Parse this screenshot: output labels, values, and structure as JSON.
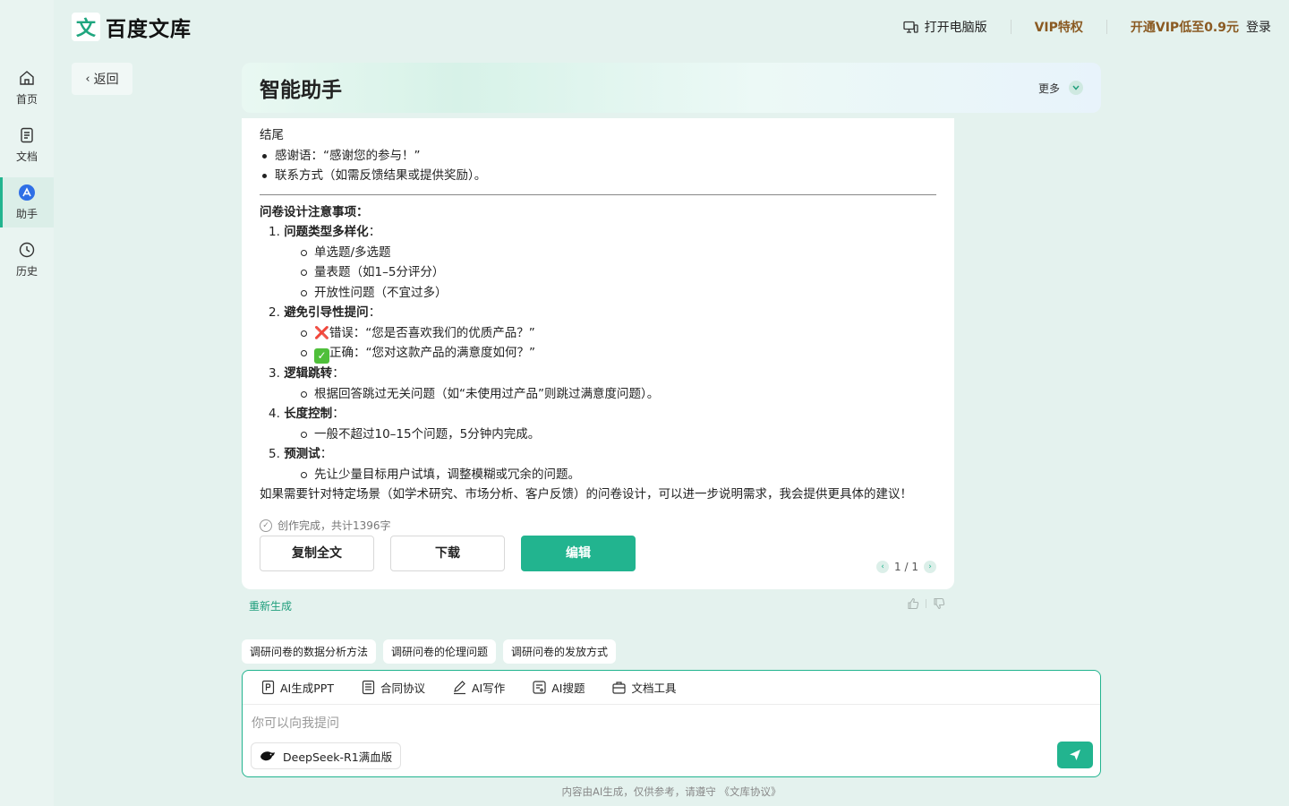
{
  "brand": {
    "mark": "文",
    "name": "百度文库"
  },
  "rail": {
    "items": [
      {
        "label": "首页",
        "icon": "home-icon"
      },
      {
        "label": "文档",
        "icon": "document-icon"
      },
      {
        "label": "助手",
        "icon": "assistant-icon",
        "active": true
      },
      {
        "label": "历史",
        "icon": "clock-icon"
      }
    ]
  },
  "topnav": {
    "desktop": "打开电脑版",
    "vip": "VIP特权",
    "vip_promo": "开通VIP低至0.9元",
    "login": "登录"
  },
  "back": {
    "label": "返回"
  },
  "assistant": {
    "title": "智能助手",
    "more": "更多"
  },
  "answer": {
    "ending_heading": "结尾",
    "ending_bullets": [
      "感谢语：“感谢您的参与！”",
      "联系方式（如需反馈结果或提供奖励）。"
    ],
    "notes_heading": "问卷设计注意事项：",
    "sections": [
      {
        "num": "1.",
        "title": "问题类型多样化",
        "colon": "：",
        "items": [
          "单选题/多选题",
          "量表题（如1–5分评分）",
          "开放性问题（不宜过多）"
        ]
      },
      {
        "num": "2.",
        "title": "避免引导性提问",
        "colon": "：",
        "items": [
          "错误：“您是否喜欢我们的优质产品？”",
          "正确：“您对这款产品的满意度如何？”"
        ]
      },
      {
        "num": "3.",
        "title": "逻辑跳转",
        "colon": "：",
        "items": [
          "根据回答跳过无关问题（如“未使用过产品”则跳过满意度问题）。"
        ]
      },
      {
        "num": "4.",
        "title": "长度控制",
        "colon": "：",
        "items": [
          "一般不超过10–15个问题，5分钟内完成。"
        ]
      },
      {
        "num": "5.",
        "title": "预测试",
        "colon": "：",
        "items": [
          "先让少量目标用户试填，调整模糊或冗余的问题。"
        ]
      }
    ],
    "closing": "如果需要针对特定场景（如学术研究、市场分析、客户反馈）的问卷设计，可以进一步说明需求，我会提供更具体的建议！",
    "status": "创作完成，共计1396字",
    "buttons": {
      "copy": "复制全文",
      "download": "下载",
      "edit": "编辑"
    },
    "pager": "1 / 1",
    "emoji": {
      "wrong": "❌",
      "right": "✓"
    }
  },
  "regenerate": "重新生成",
  "suggestions": [
    "调研问卷的数据分析方法",
    "调研问卷的伦理问题",
    "调研问卷的发放方式"
  ],
  "composer": {
    "tools": [
      "AI生成PPT",
      "合同协议",
      "AI写作",
      "AI搜题",
      "文档工具"
    ],
    "placeholder": "你可以向我提问",
    "model": "DeepSeek-R1满血版"
  },
  "disclaimer": "内容由AI生成，仅供参考，请遵守 《文库协议》",
  "colors": {
    "accent": "#22b48f",
    "vip": "#8a5a22",
    "background": "#e4f2ee"
  }
}
